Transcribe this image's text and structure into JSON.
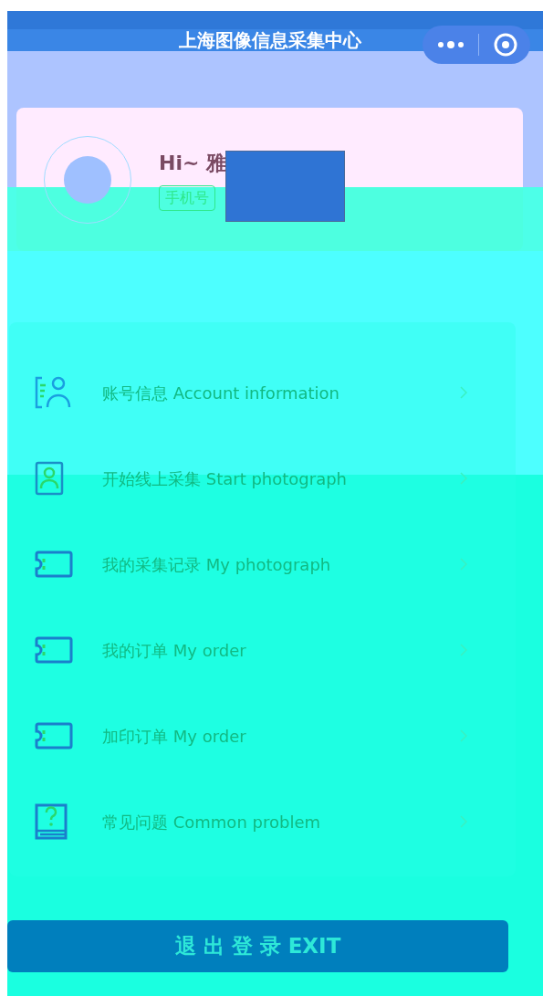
{
  "header": {
    "title": "上海图像信息采集中心"
  },
  "profile": {
    "greeting": "Hi~ 雅",
    "phone_label": "手机号"
  },
  "menu": [
    {
      "kind": "account",
      "label": "账号信息 Account information"
    },
    {
      "kind": "portrait",
      "label": "开始线上采集 Start photograph"
    },
    {
      "kind": "ticket",
      "label": "我的采集记录 My photograph"
    },
    {
      "kind": "ticket",
      "label": "我的订单 My order"
    },
    {
      "kind": "ticket",
      "label": "加印订单 My order"
    },
    {
      "kind": "help",
      "label": "常见问题 Common problem"
    }
  ],
  "exit_button": "退 出 登 录 EXIT"
}
